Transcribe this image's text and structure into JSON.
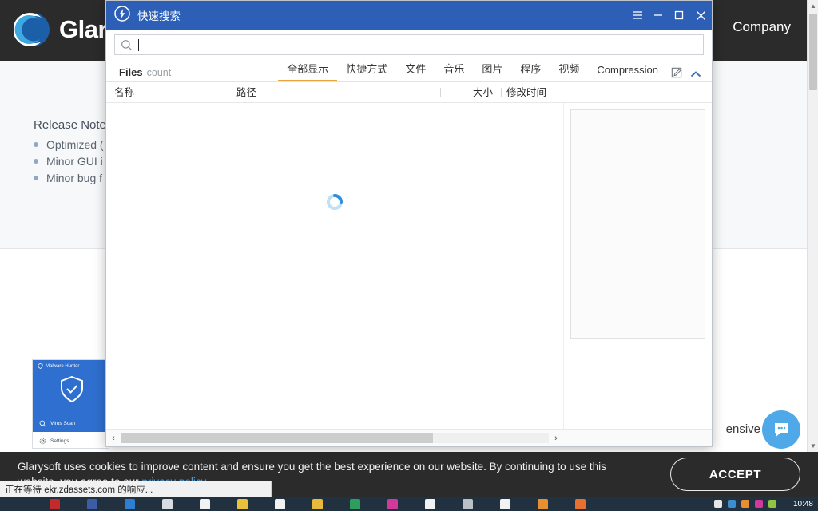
{
  "website": {
    "brand_name": "Glary",
    "logo_icon": "glary-moon-logo",
    "nav": [
      {
        "label": "Company"
      }
    ],
    "release_notes": {
      "title": "Release Notes",
      "items": [
        {
          "text": "Optimized ("
        },
        {
          "text": "Minor GUI i"
        },
        {
          "text": "Minor bug f"
        }
      ]
    },
    "background_word": "ensive",
    "malware_hunter": {
      "title": "Malware Hunter",
      "title_icon": "shield-check-icon",
      "shield_icon": "shield-check-big-icon",
      "rows": [
        {
          "label": "Virus Scan",
          "icon": "magnifier-scan-icon",
          "active": true
        },
        {
          "label": "Settings",
          "icon": "gear-icon",
          "active": false
        }
      ]
    },
    "chat_widget": {
      "icon": "chat-bubble-icon",
      "color": "#4fa8e8"
    }
  },
  "cookie_banner": {
    "text_line1": "Glarysoft uses cookies to improve content and ensure you get the best experience on our website. By continuing to use this website, you",
    "text_line2_prefix": "agree to our ",
    "link_label": "privacy policy",
    "accept_label": "ACCEPT",
    "background": "#2b2b2b"
  },
  "status_tip": {
    "text": "正在等待 ekr.zdassets.com 的响应..."
  },
  "taskbar": {
    "clock": "10:48",
    "background": "#22313f",
    "icons": [
      {
        "name": "app-icon-pdf",
        "color": "#c32b2b"
      },
      {
        "name": "app-icon-editor",
        "color": "#3b5da8"
      },
      {
        "name": "app-icon-notes",
        "color": "#2f7fd0"
      },
      {
        "name": "app-icon-media",
        "color": "#d8dce1"
      },
      {
        "name": "app-icon-document",
        "color": "#f2f2f2"
      },
      {
        "name": "app-icon-seven",
        "color": "#e8c33a"
      },
      {
        "name": "app-icon-document2",
        "color": "#f2f2f2"
      },
      {
        "name": "app-icon-folder",
        "color": "#e8b93a"
      },
      {
        "name": "app-icon-browser",
        "color": "#2f9e5c"
      },
      {
        "name": "app-icon-pink",
        "color": "#d3399b"
      },
      {
        "name": "app-icon-document3",
        "color": "#f2f2f2"
      },
      {
        "name": "app-icon-printer",
        "color": "#b9c0c7"
      },
      {
        "name": "app-icon-document4",
        "color": "#f2f2f2"
      },
      {
        "name": "app-icon-orange",
        "color": "#e8902f"
      },
      {
        "name": "app-icon-ring",
        "color": "#e8702f"
      }
    ],
    "tray": [
      {
        "name": "tray-icon-text",
        "color": "#e6e6e6"
      },
      {
        "name": "tray-icon-blue",
        "color": "#3b8fd0"
      },
      {
        "name": "tray-icon-orange",
        "color": "#e8902f"
      },
      {
        "name": "tray-icon-pink",
        "color": "#d3399b"
      },
      {
        "name": "tray-icon-green",
        "color": "#8ec63f"
      }
    ]
  },
  "quick_search": {
    "title": "快速搜索",
    "logo_icon": "lightning-bolt-icon",
    "window_buttons": [
      {
        "name": "menu-button",
        "glyph": "☰"
      },
      {
        "name": "minimize-button",
        "glyph": "–"
      },
      {
        "name": "maximize-button",
        "glyph": "□"
      },
      {
        "name": "close-button",
        "glyph": "✕"
      }
    ],
    "search": {
      "value": "",
      "placeholder": "",
      "icon": "search-icon"
    },
    "files_label": "Files",
    "count_label": "count",
    "tabs": [
      {
        "label": "全部显示",
        "active": true
      },
      {
        "label": "快捷方式",
        "active": false
      },
      {
        "label": "文件",
        "active": false
      },
      {
        "label": "音乐",
        "active": false
      },
      {
        "label": "图片",
        "active": false
      },
      {
        "label": "程序",
        "active": false
      },
      {
        "label": "视频",
        "active": false
      },
      {
        "label": "Compression",
        "active": false
      }
    ],
    "tab_actions": [
      {
        "name": "edit-tabs-icon",
        "glyph": "pencil"
      },
      {
        "name": "collapse-chevron-up-icon",
        "glyph": "chevron-up"
      }
    ],
    "columns": [
      {
        "label": "名称"
      },
      {
        "label": "路径"
      },
      {
        "label": "大小"
      },
      {
        "label": "修改时间"
      }
    ],
    "rows": [],
    "loading": true,
    "loading_color": "#2f8fe0",
    "accent_color": "#e8a33d",
    "titlebar_color": "#2c5fb5",
    "hscroll": {
      "left_glyph": "‹",
      "right_glyph": "›",
      "thumb_percent": 73
    }
  }
}
